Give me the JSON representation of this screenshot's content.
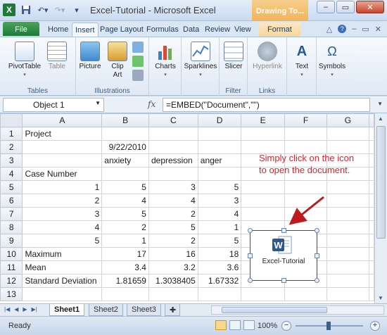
{
  "window": {
    "title": "Excel-Tutorial - Microsoft Excel",
    "contextual_tab": "Drawing To...",
    "minimize": "–",
    "restore": "▭",
    "close": "✕"
  },
  "tabs": {
    "file": "File",
    "home": "Home",
    "insert": "Insert",
    "page_layout": "Page Layout",
    "formulas": "Formulas",
    "data": "Data",
    "review": "Review",
    "view": "View",
    "format": "Format"
  },
  "ribbon": {
    "tables": {
      "pivottable": "PivotTable",
      "table": "Table",
      "label": "Tables"
    },
    "illustrations": {
      "picture": "Picture",
      "clip_art": "Clip Art",
      "label": "Illustrations"
    },
    "charts": {
      "charts": "Charts"
    },
    "sparklines": {
      "sparklines": "Sparklines"
    },
    "filter": {
      "slicer": "Slicer",
      "label": "Filter"
    },
    "links": {
      "hyperlink": "Hyperlink",
      "label": "Links"
    },
    "text": {
      "text": "Text"
    },
    "symbols": {
      "symbols": "Symbols"
    }
  },
  "formula_bar": {
    "name_box": "Object 1",
    "fx": "fx",
    "formula": "=EMBED(\"Document\",\"\")"
  },
  "grid": {
    "columns": [
      "A",
      "B",
      "C",
      "D",
      "E",
      "F",
      "G"
    ],
    "rows": [
      {
        "n": "1",
        "cells": [
          "Project",
          "",
          "",
          "",
          "",
          "",
          ""
        ]
      },
      {
        "n": "2",
        "cells": [
          "",
          "9/22/2010",
          "",
          "",
          "",
          "",
          ""
        ]
      },
      {
        "n": "3",
        "cells": [
          "",
          "anxiety",
          "depression",
          "anger",
          "",
          "",
          ""
        ]
      },
      {
        "n": "4",
        "cells": [
          "Case Number",
          "",
          "",
          "",
          "",
          "",
          ""
        ]
      },
      {
        "n": "5",
        "cells": [
          "1",
          "5",
          "3",
          "5",
          "",
          "",
          ""
        ]
      },
      {
        "n": "6",
        "cells": [
          "2",
          "4",
          "4",
          "3",
          "",
          "",
          ""
        ]
      },
      {
        "n": "7",
        "cells": [
          "3",
          "5",
          "2",
          "4",
          "",
          "",
          ""
        ]
      },
      {
        "n": "8",
        "cells": [
          "4",
          "2",
          "5",
          "1",
          "",
          "",
          ""
        ]
      },
      {
        "n": "9",
        "cells": [
          "5",
          "1",
          "2",
          "5",
          "",
          "",
          ""
        ]
      },
      {
        "n": "10",
        "cells": [
          "Maximum",
          "17",
          "16",
          "18",
          "",
          "",
          ""
        ]
      },
      {
        "n": "11",
        "cells": [
          "Mean",
          "3.4",
          "3.2",
          "3.6",
          "",
          "",
          ""
        ]
      },
      {
        "n": "12",
        "cells": [
          "Standard Deviation",
          "1.81659",
          "1.3038405",
          "1.67332",
          "",
          "",
          ""
        ]
      },
      {
        "n": "13",
        "cells": [
          "",
          "",
          "",
          "",
          "",
          "",
          ""
        ]
      }
    ]
  },
  "annotation": "Simply click on the icon to open the document.",
  "embedded_object": {
    "label": "Excel-Tutorial",
    "icon_letter": "W"
  },
  "sheets": [
    "Sheet1",
    "Sheet2",
    "Sheet3"
  ],
  "status": {
    "ready": "Ready",
    "zoom": "100%"
  },
  "colors": {
    "annotation": "#e0222a",
    "file_tab": "#1f7a3a",
    "contextual": "#f1b35a"
  }
}
